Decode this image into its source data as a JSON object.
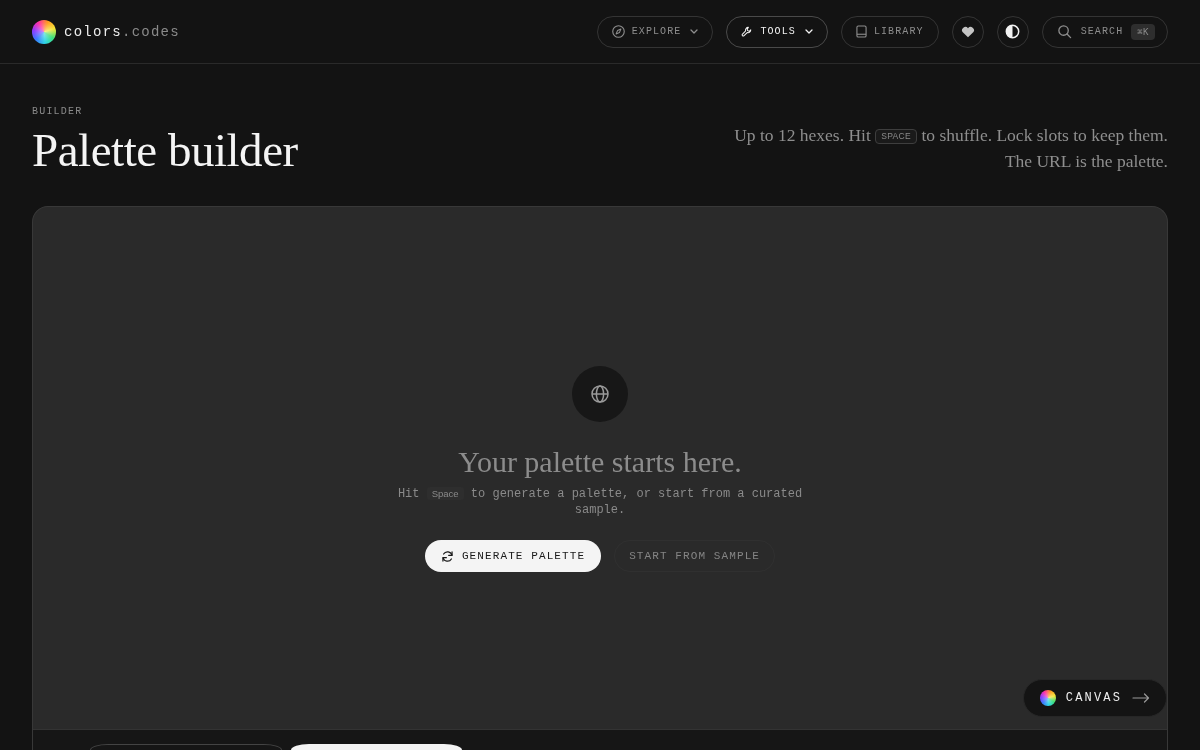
{
  "header": {
    "brand": {
      "name": "colors",
      "suffix": ".codes"
    },
    "nav": [
      {
        "label": "EXPLORE",
        "kind": "menu",
        "selected": false
      },
      {
        "label": "TOOLS",
        "kind": "menu",
        "selected": true
      },
      {
        "label": "LIBRARY",
        "kind": "link",
        "selected": false
      }
    ],
    "search": {
      "label": "SEARCH",
      "shortcut": "⌘K"
    }
  },
  "page_header": {
    "eyebrow": "BUILDER",
    "title": "Palette builder",
    "intro": {
      "before": "Up to 12 hexes. Hit",
      "key": "SPACE",
      "after": "to shuffle. Lock slots to keep them.",
      "note": "The URL is the palette."
    }
  },
  "builder": {
    "empty_state": {
      "heading": "Your palette starts here.",
      "hint_before": "Hit",
      "hint_key": "Space",
      "hint_after": "to generate a palette, or start from a curated sample.",
      "buttons": [
        {
          "label": "GENERATE PALETTE",
          "kind": "primary"
        },
        {
          "label": "START FROM SAMPLE",
          "kind": "secondary"
        }
      ]
    },
    "canvas_button": {
      "label": "CANVAS"
    }
  }
}
